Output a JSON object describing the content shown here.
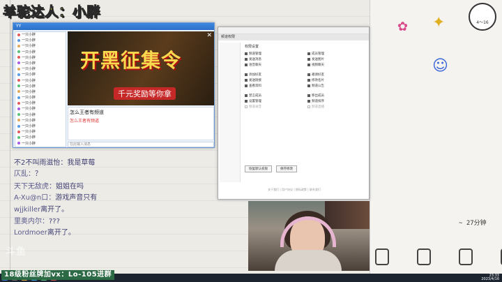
{
  "overlay": {
    "streamer_title": "羊驼达人：小胖",
    "fan_banner": "18级粉丝牌加vx：Lo-105进群",
    "watermark": "斗鱼",
    "countdown": "~ 27分钟"
  },
  "chat": [
    {
      "nick": "",
      "msg": "不2不叫雨滋怡：我是草莓"
    },
    {
      "nick": "仄乱：",
      "msg": "？"
    },
    {
      "nick": "天下无敌虎：",
      "msg": "姐姐在吗"
    },
    {
      "nick": "A-Xu@n口：",
      "msg": "游戏声音只有"
    },
    {
      "nick": "wjjkiller",
      "msg": "离开了。"
    },
    {
      "nick": "里奥内尔：",
      "msg": "???"
    },
    {
      "nick": "Lordmoer",
      "msg": "离开了。"
    }
  ],
  "yy_window": {
    "title": "YY",
    "banner_title": "开黑征集令",
    "banner_subtitle": "千元奖励等你拿",
    "list_rows": [
      "一只小胖",
      "一只小胖",
      "一只小胖",
      "一只小胖",
      "一只小胖",
      "一只小胖",
      "一只小胖",
      "一只小胖",
      "一只小胖",
      "一只小胖",
      "一只小胖",
      "一只小胖",
      "一只小胖",
      "一只小胖",
      "一只小胖",
      "一只小胖",
      "一只小胖",
      "一只小胖",
      "一只小胖",
      "一只小胖"
    ],
    "chat_question": "怎么王者有频道",
    "chat_red": "怎么王者有频道",
    "input_placeholder": "在此输入消息"
  },
  "browser": {
    "tab_label": "频道权限",
    "permission_title": "权限设置",
    "permissions": [
      {
        "label": "频道管理",
        "on": true
      },
      {
        "label": "成员管理",
        "on": true
      },
      {
        "label": "发送消息",
        "on": true
      },
      {
        "label": "发送图片",
        "on": true
      },
      {
        "label": "语音聊天",
        "on": true
      },
      {
        "label": "视频聊天",
        "on": true
      },
      {
        "label": "添加好友",
        "on": true
      },
      {
        "label": "邀请好友",
        "on": true
      },
      {
        "label": "发送链接",
        "on": true
      },
      {
        "label": "修改名片",
        "on": true
      },
      {
        "label": "查看资料",
        "on": true
      },
      {
        "label": "频道公告",
        "on": true
      },
      {
        "label": "禁言成员",
        "on": true
      },
      {
        "label": "移出成员",
        "on": true
      },
      {
        "label": "设置管理",
        "on": true
      },
      {
        "label": "频道排序",
        "on": true
      },
      {
        "label": "频道录音",
        "on": false
      },
      {
        "label": "频道直播",
        "on": false
      }
    ],
    "save_button": "恢复默认权限",
    "cancel_button": "保存修改",
    "footer": "关于我们 | 用户协议 | 隐私政策 | 联系我们"
  },
  "right_panel": {
    "cloud_label": "4～16"
  },
  "taskbar": {
    "time": "23:33",
    "date": "2023/4/16"
  }
}
